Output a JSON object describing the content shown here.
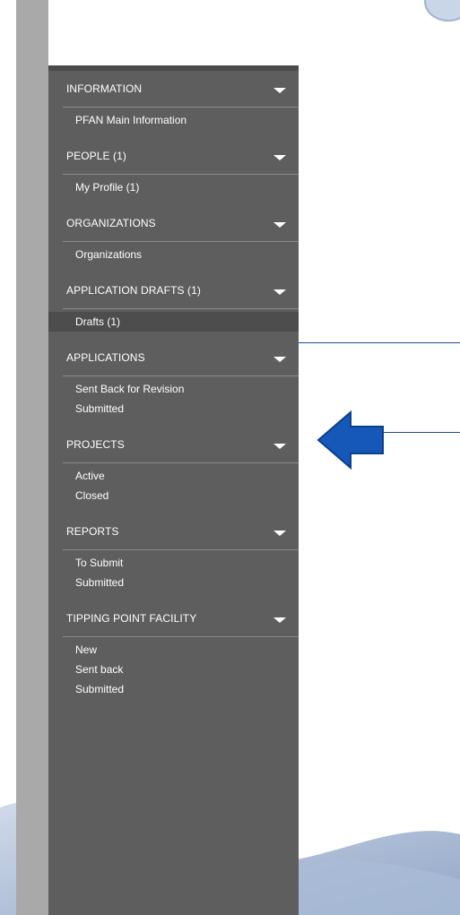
{
  "sidebar": {
    "sections": [
      {
        "title": "INFORMATION",
        "items": [
          "PFAN Main Information"
        ]
      },
      {
        "title": "PEOPLE (1)",
        "items": [
          "My Profile  (1)"
        ]
      },
      {
        "title": "ORGANIZATIONS",
        "items": [
          "Organizations"
        ]
      },
      {
        "title": "APPLICATION DRAFTS (1)",
        "items": [
          "Drafts  (1)"
        ]
      },
      {
        "title": "APPLICATIONS",
        "items": [
          "Sent Back for Revision",
          "Submitted"
        ]
      },
      {
        "title": "PROJECTS",
        "items": [
          "Active",
          "Closed"
        ]
      },
      {
        "title": "REPORTS",
        "items": [
          "To Submit",
          "Submitted"
        ]
      },
      {
        "title": "TIPPING POINT FACILITY",
        "items": [
          "New",
          "Sent back",
          "Submitted"
        ]
      }
    ],
    "active_item": "Drafts  (1)"
  },
  "icons": {
    "section_toggle": "chevron-down-icon",
    "callout": "left-arrow-icon"
  },
  "colors": {
    "sidebar_bg": "#5e5e5e",
    "active_item_bg": "#4d4d4d",
    "strip": "#a9a9a9",
    "arrow": "#1658b8"
  }
}
